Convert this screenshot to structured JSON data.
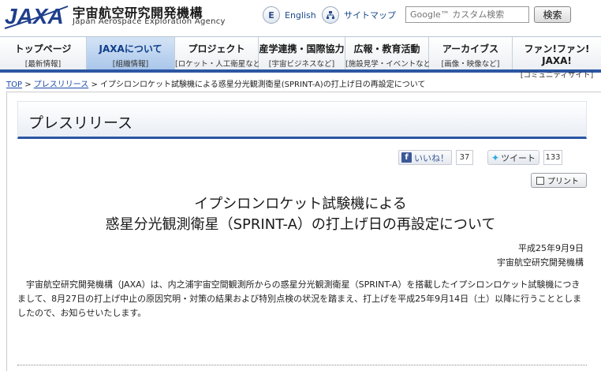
{
  "header": {
    "logo_text": "JAXA",
    "org_name": "宇宙航空研究開発機構",
    "org_name_en": "Japan Aerospace Exploration Agency",
    "english_icon": "E",
    "english_label": "English",
    "sitemap_label": "サイトマップ",
    "search_placeholder": "Google™ カスタム検索",
    "search_button": "検索"
  },
  "nav": [
    {
      "main": "トップページ",
      "sub": "[最新情報]"
    },
    {
      "main": "JAXAについて",
      "sub": "[組織情報]"
    },
    {
      "main": "プロジェクト",
      "sub": "[ロケット・人工衛星など]"
    },
    {
      "main": "産学連携・国際協力",
      "sub": "[宇宙ビジネスなど]"
    },
    {
      "main": "広報・教育活動",
      "sub": "[施設見学・イベントなど]"
    },
    {
      "main": "アーカイブス",
      "sub": "[画像・映像など]"
    },
    {
      "main": "ファン!ファン! JAXA!",
      "sub": "[コミュニティサイト]"
    }
  ],
  "breadcrumb": {
    "top": "TOP",
    "sep": " > ",
    "press": "プレスリリース",
    "current": "イプシロンロケット試験機による惑星分光観測衛星(SPRINT-A)の打上げ日の再設定について"
  },
  "section_title": "プレスリリース",
  "social": {
    "fb_label": "いいね！",
    "fb_count": "37",
    "tw_label": "ツイート",
    "tw_count": "133",
    "print_label": "プリント"
  },
  "article": {
    "title_line1": "イプシロンロケット試験機による",
    "title_line2": "惑星分光観測衛星（SPRINT-A）の打上げ日の再設定について",
    "date": "平成25年9月9日",
    "org": "宇宙航空研究開発機構",
    "body": "宇宙航空研究開発機構（JAXA）は、内之浦宇宙空間観測所からの惑星分光観測衛星（SPRINT-A）を搭載したイプシロンロケット試験機につきまして、8月27日の打上げ中止の原因究明・対策の結果および特別点検の状況を踏まえ、打上げを平成25年9月14日（土）以降に行うこととしましたので、お知らせいたします。"
  },
  "colors": {
    "accent": "#2b56a3",
    "nav_active": "#a9c6ea",
    "link": "#1a4aa8"
  }
}
